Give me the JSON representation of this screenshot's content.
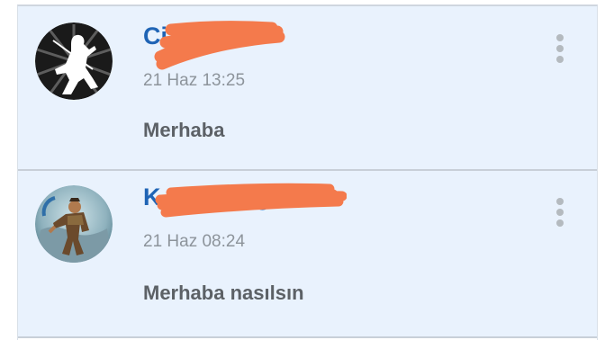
{
  "messages": [
    {
      "username": "Ci          on_",
      "timestamp": "21 Haz 13:25",
      "text": "Merhaba",
      "avatar_icon": "ninja-silhouette-avatar",
      "menu_icon": "more-vert-icon"
    },
    {
      "username": "K                      omerang",
      "timestamp": "21 Haz 08:24",
      "text": "Merhaba nasılsın",
      "avatar_icon": "warrior-painting-avatar",
      "menu_icon": "more-vert-icon"
    }
  ],
  "colors": {
    "card_background": "#e9f2fd",
    "username": "#1f64b5",
    "timestamp": "#8d949b",
    "message": "#5c6166",
    "redaction": "#f47a4c"
  }
}
